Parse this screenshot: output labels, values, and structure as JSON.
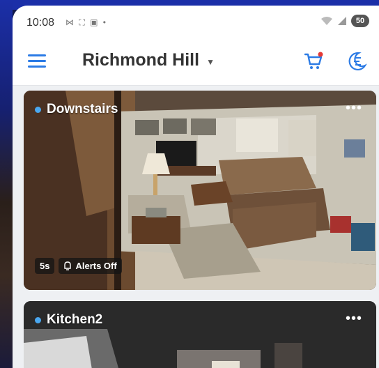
{
  "status_bar": {
    "time": "10:08",
    "left_icons": "⋈ ⛶ ▣ •",
    "battery": "50"
  },
  "app_bar": {
    "location": "Richmond Hill",
    "menu_icon": "hamburger-menu-icon",
    "cart_icon": "cart-icon",
    "mode_icon": "moon-icon"
  },
  "cameras": [
    {
      "name": "Downstairs",
      "live": true,
      "interval": "5s",
      "alerts": "Alerts Off",
      "more": "•••"
    },
    {
      "name": "Kitchen2",
      "live": true,
      "more": "•••"
    }
  ],
  "colors": {
    "accent": "#2c7be5",
    "live_dot": "#4aa8f0",
    "cart_badge": "#e53935"
  }
}
